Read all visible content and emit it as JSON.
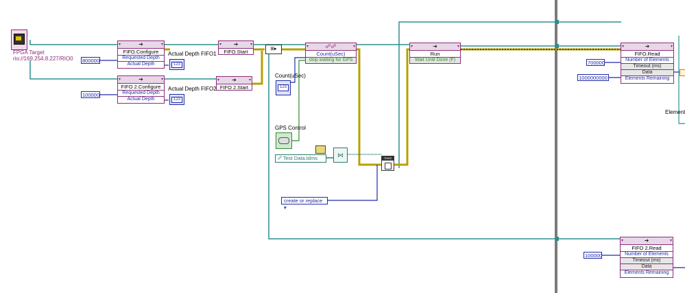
{
  "fpga": {
    "title": "FPGA Target",
    "address": "rio://169.254.8.227/RIO0"
  },
  "constants": {
    "depth_fifo1": "800000",
    "depth_fifo2": "100000",
    "fifo_read_elements": "700000",
    "fifo_read_timeout": "1000000000",
    "fifo2_read_elements": "100000"
  },
  "nodes": {
    "fifo_configure": {
      "title": "FIFO.Configure",
      "props": [
        "Requested Depth",
        "Actual Depth"
      ]
    },
    "fifo2_configure": {
      "title": "FIFO 2.Configure",
      "props": [
        "Requested Depth",
        "Actual Depth"
      ]
    },
    "fifo_start": {
      "title": "FIFO.Start"
    },
    "fifo2_start": {
      "title": "FIFO 2.Start"
    },
    "count": {
      "title": "Count(uSec)",
      "props": [
        "stop waiting for GPS"
      ]
    },
    "run": {
      "title": "Run",
      "props": [
        "Wait Until Done (F)"
      ]
    },
    "fifo_read": {
      "title": "FIFO.Read",
      "props": [
        "Number of Elements",
        "Timeout (ms)",
        "Data",
        "Elements Remaining"
      ]
    },
    "fifo2_read": {
      "title": "FIFO 2.Read",
      "props": [
        "Number of Elements",
        "Timeout (ms)",
        "Data",
        "Elements Remaining"
      ]
    }
  },
  "labels": {
    "actual_depth_fifo1": "Actual Depth FIFO1",
    "actual_depth_fifo2": "Actual Depth FIFO2",
    "count_usec": "Count(uSec)",
    "gps_control": "GPS Control",
    "elements": "Elements"
  },
  "indicators": {
    "numeric_symbol": "123"
  },
  "file": {
    "path": "Test Data.tdms",
    "operation": "create or replace",
    "tdms_tag": "TDMS"
  },
  "colors": {
    "wire_teal": "#2b8f8f",
    "wire_blue": "#1f2aa8",
    "wire_error": "#b7a000",
    "node_border": "#8a2d7a",
    "frame_divider": "#7a7a7a"
  }
}
